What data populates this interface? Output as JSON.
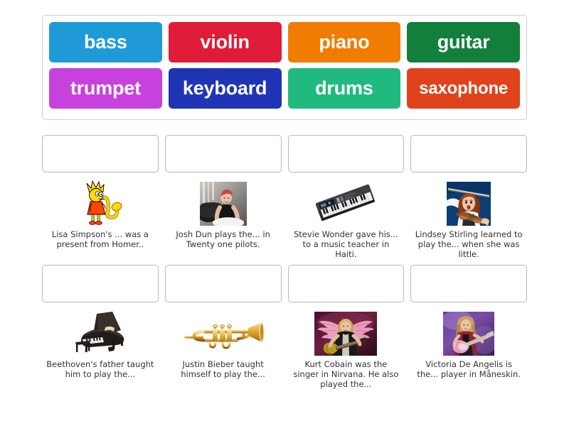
{
  "activity": {
    "type": "match-up-drag-and-drop",
    "topic": "Musical instruments"
  },
  "word_bank": {
    "rows": [
      [
        {
          "label": "bass",
          "color": "#1f9ad6"
        },
        {
          "label": "violin",
          "color": "#de1c38"
        },
        {
          "label": "piano",
          "color": "#f07c00"
        },
        {
          "label": "guitar",
          "color": "#12803b"
        }
      ],
      [
        {
          "label": "trumpet",
          "color": "#c742dd"
        },
        {
          "label": "keyboard",
          "color": "#1f35b5"
        },
        {
          "label": "drums",
          "color": "#20ba81"
        },
        {
          "label": "saxophone",
          "color": "#e0431c"
        }
      ]
    ]
  },
  "questions": [
    {
      "caption": "Lisa Simpson's ... was a present from Homer..",
      "image": "lisa-simpson-saxophone-image",
      "drop_zone_value": ""
    },
    {
      "caption": "Josh Dun plays the... in Twenty one pilots.",
      "image": "josh-dun-drums-photo",
      "drop_zone_value": ""
    },
    {
      "caption": "Stevie Wonder gave his... to a music teacher in Haiti.",
      "image": "electronic-keyboard-image",
      "drop_zone_value": ""
    },
    {
      "caption": "Lindsey Stirling learned to play the... when she was little.",
      "image": "lindsey-stirling-violin-photo",
      "drop_zone_value": ""
    },
    {
      "caption": "Beethoven's father taught him to play the...",
      "image": "grand-piano-image",
      "drop_zone_value": ""
    },
    {
      "caption": "Justin Bieber taught himself to play the...",
      "image": "trumpet-image",
      "drop_zone_value": ""
    },
    {
      "caption": "Kurt Cobain was the singer in Nirvana. He also played the...",
      "image": "kurt-cobain-guitar-photo",
      "drop_zone_value": ""
    },
    {
      "caption": "Victoria De Angelis is the... player in Måneskin.",
      "image": "victoria-de-angelis-bass-photo",
      "drop_zone_value": ""
    }
  ]
}
